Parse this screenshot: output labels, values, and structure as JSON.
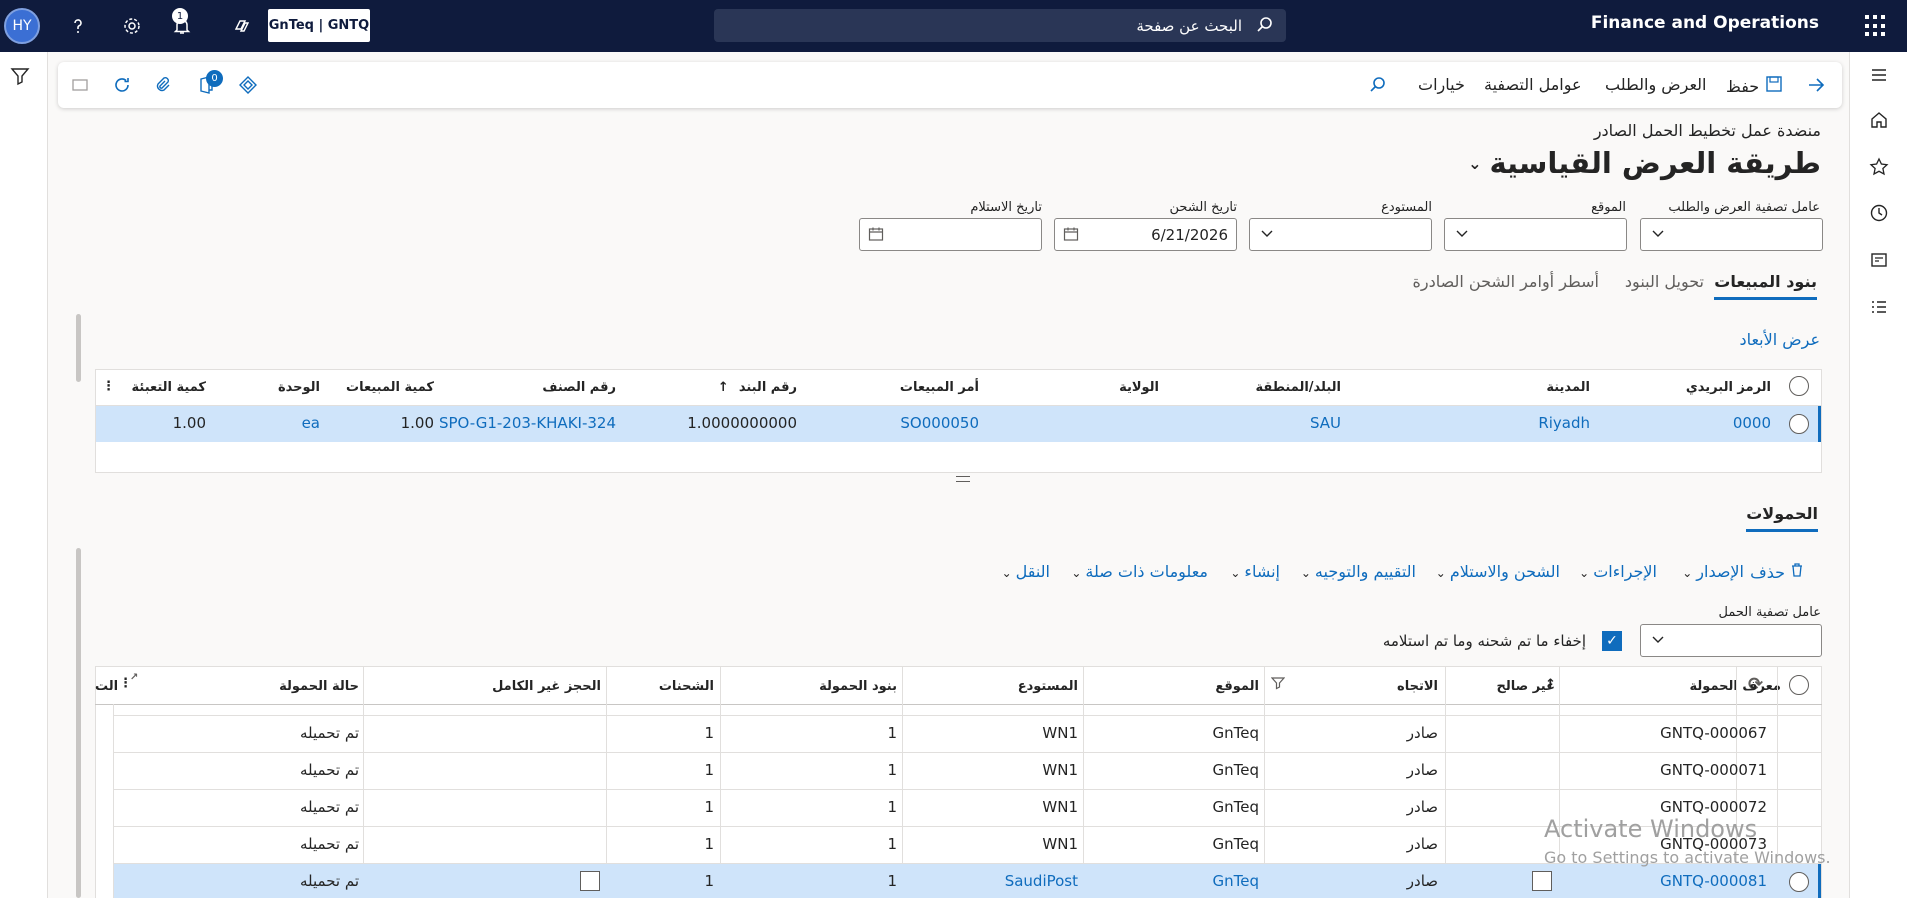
{
  "topbar": {
    "avatar_initials": "HY",
    "notification_count": "1",
    "company": "GnTeq | GNTQ",
    "search_placeholder": "البحث عن صفحة",
    "app_title": "Finance and Operations"
  },
  "actionbar": {
    "save": "حفظ",
    "supply_demand": "العرض والطلب",
    "filters": "عوامل التصفية",
    "options": "خيارات",
    "attachments_count": "0"
  },
  "page": {
    "breadcrumb": "منضدة عمل تخطيط الحمل الصادر",
    "title": "طريقة العرض القياسية"
  },
  "filters": {
    "supply_demand_filter_label": "عامل تصفية العرض والطلب",
    "site_label": "الموقع",
    "warehouse_label": "المستودع",
    "ship_date_label": "تاريخ الشحن",
    "ship_date_value": "6/21/2026",
    "receipt_date_label": "تاريخ الاستلام"
  },
  "tabs": [
    {
      "label": "بنود المبيعات",
      "active": true
    },
    {
      "label": "تحويل البنود",
      "active": false
    },
    {
      "label": "أسطر أوامر الشحن الصادرة",
      "active": false
    }
  ],
  "sales_lines": {
    "show_dimensions": "عرض الأبعاد",
    "headers": {
      "postal_code": "الرمز البريدي",
      "city": "المدينة",
      "country": "البلد/المنطقة",
      "state": "الولاية",
      "sales_order": "أمر المبيعات",
      "line_number": "رقم البند",
      "item_number": "رقم الصنف",
      "sales_qty": "كمية المبيعات",
      "unit": "الوحدة",
      "packing_qty": "كمية التعبئة"
    },
    "rows": [
      {
        "postal_code": "0000",
        "city": "Riyadh",
        "country": "SAU",
        "state": "",
        "sales_order": "SO000050",
        "line_number": "1.0000000000",
        "item_number": "SPO-G1-203-KHAKI-324",
        "sales_qty": "1.00",
        "unit": "ea",
        "packing_qty": "1.00"
      }
    ]
  },
  "loads": {
    "tab_label": "الحمولات",
    "toolbar": {
      "delete": "حذف",
      "release": "الإصدار",
      "actions": "الإجراءات",
      "ship_receive": "الشحن والاستلام",
      "rating_routing": "التقييم والتوجيه",
      "create": "إنشاء",
      "related_info": "معلومات ذات صلة",
      "transport": "النقل"
    },
    "load_filter_label": "عامل تصفية الحمل",
    "hide_shipped_label": "إخفاء ما تم شحنه وما تم استلامه",
    "hide_shipped_checked": true,
    "headers": {
      "load_id": "معرف الحمولة",
      "invalid": "غير صالح",
      "direction": "الاتجاه",
      "site": "الموقع",
      "warehouse": "المستودع",
      "load_lines": "بنود الحمولة",
      "shipments": "الشحنات",
      "incomplete_reservation": "الحجز غير الكامل",
      "load_status": "حالة الحمولة",
      "more": "الت"
    },
    "rows": [
      {
        "load_id": "GNTQ-000067",
        "direction": "صادر",
        "site": "GnTeq",
        "warehouse": "WN1",
        "load_lines": "1",
        "shipments": "1",
        "load_status": "تم تحميله",
        "selected": false
      },
      {
        "load_id": "GNTQ-000071",
        "direction": "صادر",
        "site": "GnTeq",
        "warehouse": "WN1",
        "load_lines": "1",
        "shipments": "1",
        "load_status": "تم تحميله",
        "selected": false
      },
      {
        "load_id": "GNTQ-000072",
        "direction": "صادر",
        "site": "GnTeq",
        "warehouse": "WN1",
        "load_lines": "1",
        "shipments": "1",
        "load_status": "تم تحميله",
        "selected": false
      },
      {
        "load_id": "GNTQ-000073",
        "direction": "صادر",
        "site": "GnTeq",
        "warehouse": "WN1",
        "load_lines": "1",
        "shipments": "1",
        "load_status": "تم تحميله",
        "selected": false
      },
      {
        "load_id": "GNTQ-000081",
        "direction": "صادر",
        "site": "GnTeq",
        "warehouse": "SaudiPost",
        "load_lines": "1",
        "shipments": "1",
        "load_status": "تم تحميله",
        "selected": true
      }
    ]
  },
  "watermark": {
    "line1": "Activate Windows",
    "line2": "Go to Settings to activate Windows."
  },
  "colors": {
    "accent": "#0f6cbd",
    "topbar": "#0f1b3d",
    "selected_row": "#cfe4fa"
  }
}
